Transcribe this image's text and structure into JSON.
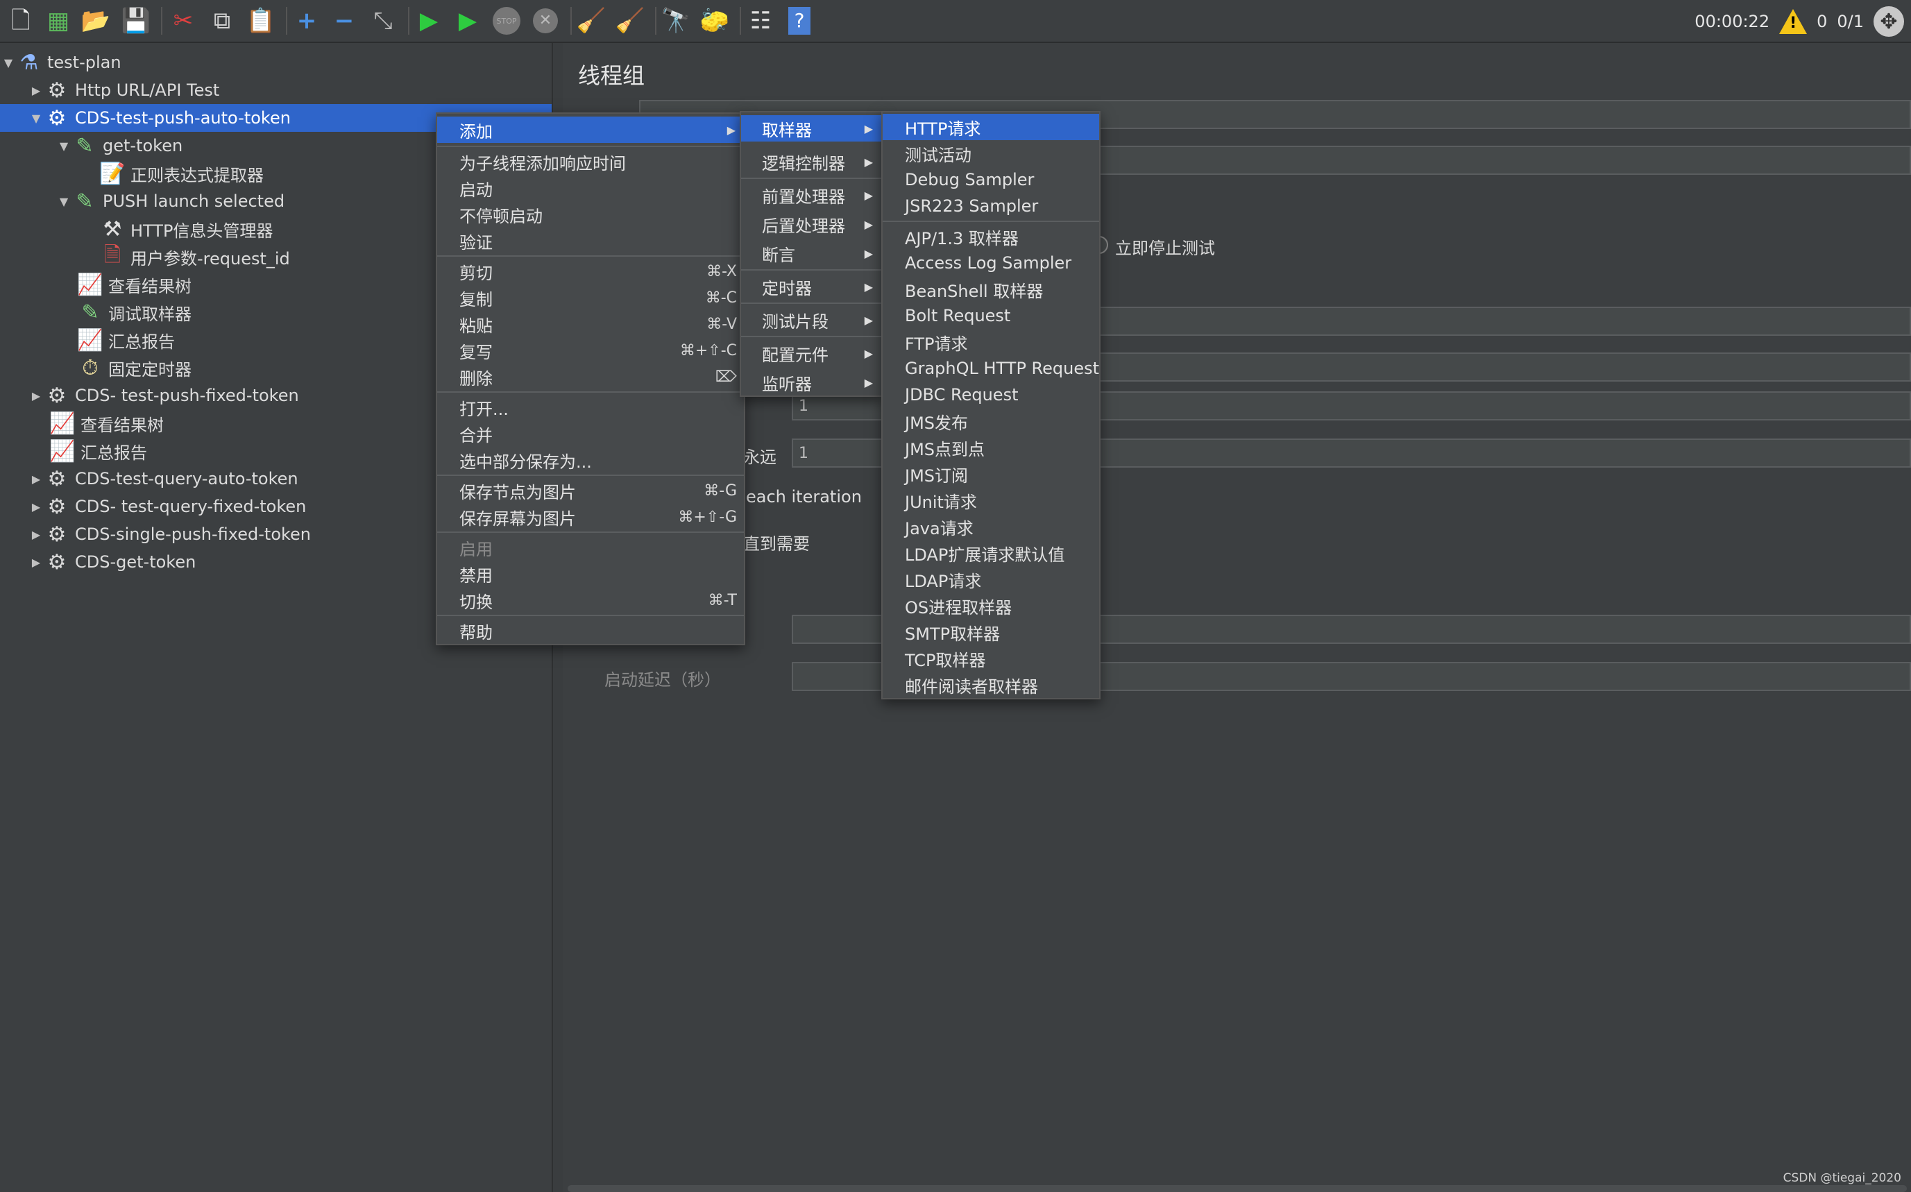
{
  "toolbar": {
    "icons": [
      "new-icon",
      "templates-icon",
      "open-icon",
      "save-icon",
      "cut-icon",
      "copy-icon",
      "paste-icon",
      "expand-icon",
      "collapse-icon",
      "toggle-icon",
      "start-icon",
      "start-no-pause-icon",
      "stop-icon",
      "shutdown-icon",
      "clear-icon",
      "clear-all-icon",
      "search-icon",
      "reset-search-icon",
      "function-helper-icon",
      "help-icon"
    ],
    "timer": "00:00:22",
    "warnings": "0",
    "threads": "0/1"
  },
  "tree": {
    "items": [
      {
        "label": "test-plan",
        "icon": "test-plan-icon"
      },
      {
        "label": "Http URL/API Test",
        "icon": "gear-icon"
      },
      {
        "label": "CDS-test-push-auto-token",
        "icon": "gear-icon"
      },
      {
        "label": "get-token",
        "icon": "sampler-icon"
      },
      {
        "label": "正则表达式提取器",
        "icon": "extractor-icon"
      },
      {
        "label": "PUSH launch selected",
        "icon": "sampler-icon"
      },
      {
        "label": "HTTP信息头管理器",
        "icon": "tools-icon"
      },
      {
        "label": "用户参数-request_id",
        "icon": "params-icon"
      },
      {
        "label": "查看结果树",
        "icon": "listener-icon"
      },
      {
        "label": "调试取样器",
        "icon": "sampler-icon"
      },
      {
        "label": "汇总报告",
        "icon": "listener-icon"
      },
      {
        "label": "固定定时器",
        "icon": "timer-icon"
      },
      {
        "label": "CDS- test-push-fixed-token",
        "icon": "gear-icon"
      },
      {
        "label": "查看结果树",
        "icon": "listener-icon"
      },
      {
        "label": "汇总报告",
        "icon": "listener-icon"
      },
      {
        "label": "CDS-test-query-auto-token",
        "icon": "gear-icon"
      },
      {
        "label": "CDS- test-query-fixed-token",
        "icon": "gear-icon"
      },
      {
        "label": "CDS-single-push-fixed-token",
        "icon": "gear-icon"
      },
      {
        "label": "CDS-get-token",
        "icon": "gear-icon"
      }
    ]
  },
  "panel": {
    "title": "线程组",
    "stop_now_label": "立即停止测试",
    "field_1": "1",
    "forever_label": "永远",
    "field_2": "1",
    "each_iteration_label": "each iteration",
    "until_needed_label": "直到需要",
    "startup_delay_label": "启动延迟（秒）"
  },
  "context_menu": {
    "items": [
      {
        "label": "添加",
        "submenu": true
      },
      {
        "label": "为子线程添加响应时间"
      },
      {
        "label": "启动"
      },
      {
        "label": "不停顿启动"
      },
      {
        "label": "验证"
      },
      {
        "label": "剪切",
        "shortcut": "⌘-X"
      },
      {
        "label": "复制",
        "shortcut": "⌘-C"
      },
      {
        "label": "粘贴",
        "shortcut": "⌘-V"
      },
      {
        "label": "复写",
        "shortcut": "⌘+⇧-C"
      },
      {
        "label": "删除",
        "shortcut": "⌦"
      },
      {
        "label": "打开..."
      },
      {
        "label": "合并"
      },
      {
        "label": "选中部分保存为..."
      },
      {
        "label": "保存节点为图片",
        "shortcut": "⌘-G"
      },
      {
        "label": "保存屏幕为图片",
        "shortcut": "⌘+⇧-G"
      },
      {
        "label": "启用",
        "disabled": true
      },
      {
        "label": "禁用"
      },
      {
        "label": "切换",
        "shortcut": "⌘-T"
      },
      {
        "label": "帮助"
      }
    ]
  },
  "add_submenu": {
    "items": [
      "取样器",
      "逻辑控制器",
      "前置处理器",
      "后置处理器",
      "断言",
      "定时器",
      "测试片段",
      "配置元件",
      "监听器"
    ]
  },
  "sampler_submenu": {
    "items": [
      "HTTP请求",
      "测试活动",
      "Debug Sampler",
      "JSR223 Sampler",
      "AJP/1.3 取样器",
      "Access Log Sampler",
      "BeanShell 取样器",
      "Bolt Request",
      "FTP请求",
      "GraphQL HTTP Request",
      "JDBC Request",
      "JMS发布",
      "JMS点到点",
      "JMS订阅",
      "JUnit请求",
      "Java请求",
      "LDAP扩展请求默认值",
      "LDAP请求",
      "OS进程取样器",
      "SMTP取样器",
      "TCP取样器",
      "邮件阅读者取样器"
    ]
  },
  "watermark": "CSDN @tiegai_2020"
}
